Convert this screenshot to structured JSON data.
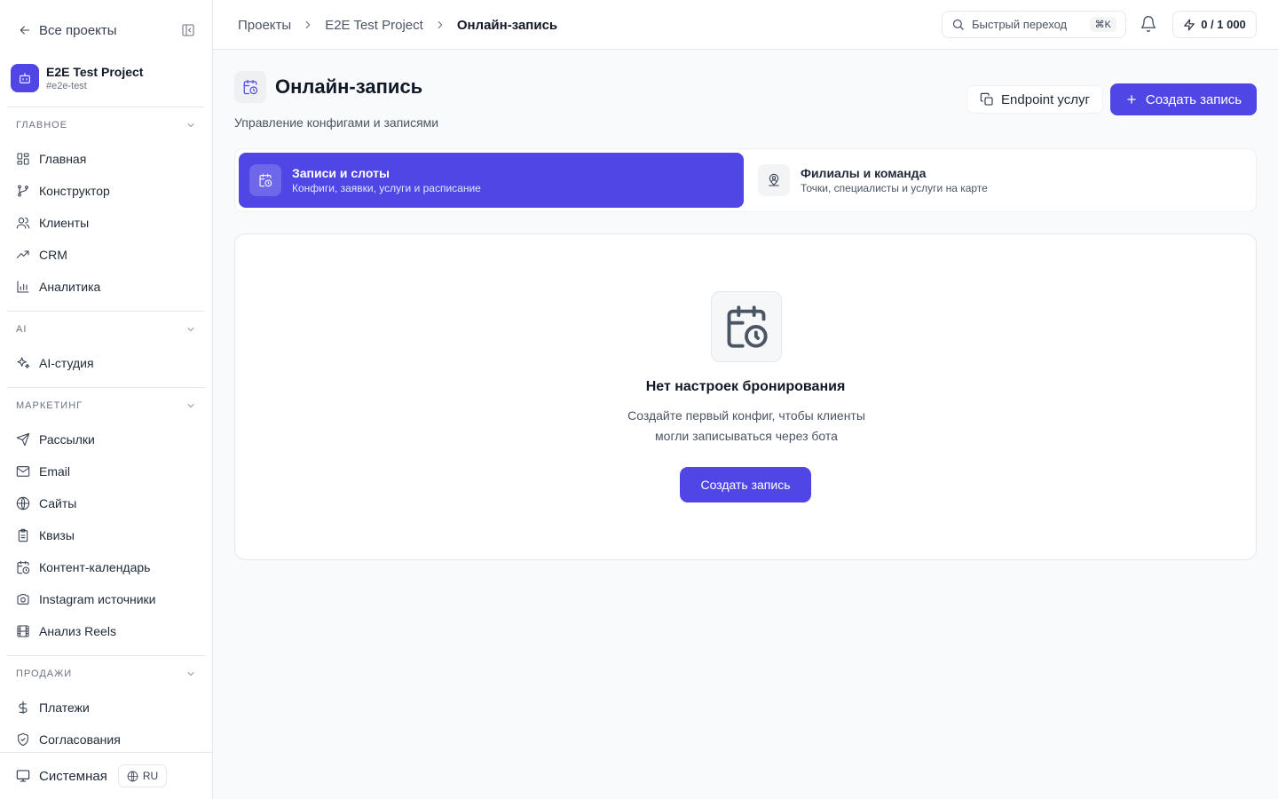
{
  "sidebar": {
    "back_label": "Все проекты",
    "project": {
      "name": "E2E Test Project",
      "slug": "#e2e-test"
    },
    "sections": [
      {
        "title": "Главное",
        "items": [
          {
            "label": "Главная",
            "icon": "dashboard-icon"
          },
          {
            "label": "Конструктор",
            "icon": "flow-icon"
          },
          {
            "label": "Клиенты",
            "icon": "users-icon"
          },
          {
            "label": "CRM",
            "icon": "trending-icon"
          },
          {
            "label": "Аналитика",
            "icon": "bar-chart-icon"
          }
        ]
      },
      {
        "title": "AI",
        "items": [
          {
            "label": "AI-студия",
            "icon": "sparkles-icon"
          }
        ]
      },
      {
        "title": "Маркетинг",
        "items": [
          {
            "label": "Рассылки",
            "icon": "send-icon"
          },
          {
            "label": "Email",
            "icon": "mail-icon"
          },
          {
            "label": "Сайты",
            "icon": "globe-icon"
          },
          {
            "label": "Квизы",
            "icon": "clipboard-icon"
          },
          {
            "label": "Контент-календарь",
            "icon": "calendar-clock-icon"
          },
          {
            "label": "Instagram источники",
            "icon": "camera-icon"
          },
          {
            "label": "Анализ Reels",
            "icon": "film-icon"
          }
        ]
      },
      {
        "title": "Продажи",
        "items": [
          {
            "label": "Платежи",
            "icon": "dollar-icon"
          },
          {
            "label": "Согласования",
            "icon": "shield-check-icon"
          }
        ]
      }
    ],
    "footer": {
      "theme_label": "Системная",
      "lang_label": "RU"
    }
  },
  "topbar": {
    "breadcrumbs": [
      "Проекты",
      "E2E Test Project",
      "Онлайн-запись"
    ],
    "search_label": "Быстрый переход",
    "search_shortcut": "⌘K",
    "quota_label": "0 / 1 000"
  },
  "page": {
    "title": "Онлайн-запись",
    "subtitle": "Управление конфигами и записями",
    "endpoint_button": "Endpoint услуг",
    "create_button": "Создать запись"
  },
  "tabs": [
    {
      "title": "Записи и слоты",
      "description": "Конфиги, заявки, услуги и расписание",
      "active": true
    },
    {
      "title": "Филиалы и команда",
      "description": "Точки, специалисты и услуги на карте",
      "active": false
    }
  ],
  "empty_state": {
    "title": "Нет настроек бронирования",
    "description_line1": "Создайте первый конфиг, чтобы клиенты",
    "description_line2": "могли записываться через бота",
    "button": "Создать запись"
  },
  "colors": {
    "accent": "#4f46e5"
  }
}
